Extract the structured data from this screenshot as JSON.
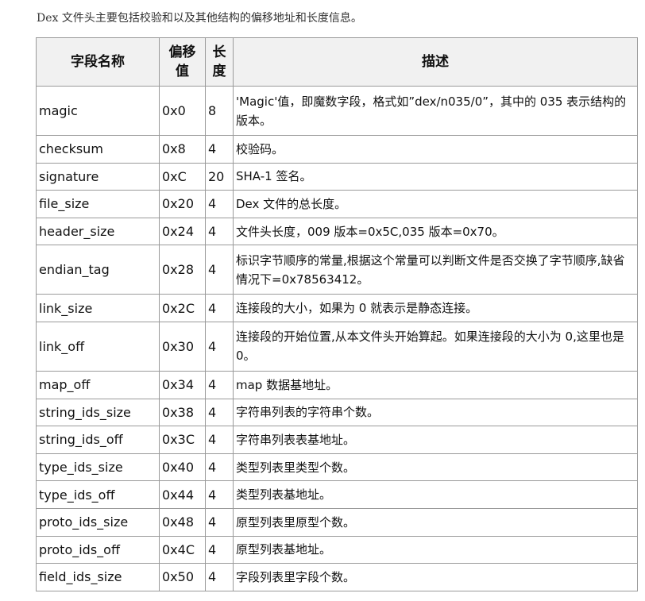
{
  "intro": "Dex 文件头主要包括校验和以及其他结构的偏移地址和长度信息。",
  "table": {
    "headers": {
      "field": "字段名称",
      "offset": "偏移值",
      "length": "长度",
      "description": "描述"
    },
    "rows": [
      {
        "field": "magic",
        "offset": "0x0",
        "length": "8",
        "description": "'Magic'值，即魔数字段，格式如”dex/n035/0”，其中的 035 表示结构的版本。"
      },
      {
        "field": "checksum",
        "offset": "0x8",
        "length": "4",
        "description": "校验码。"
      },
      {
        "field": "signature",
        "offset": "0xC",
        "length": "20",
        "description": "SHA-1 签名。"
      },
      {
        "field": "file_size",
        "offset": "0x20",
        "length": "4",
        "description": "Dex 文件的总长度。"
      },
      {
        "field": "header_size",
        "offset": "0x24",
        "length": "4",
        "description": "文件头长度，009 版本=0x5C,035 版本=0x70。"
      },
      {
        "field": "endian_tag",
        "offset": "0x28",
        "length": "4",
        "description": "标识字节顺序的常量,根据这个常量可以判断文件是否交换了字节顺序,缺省情况下=0x78563412。"
      },
      {
        "field": "link_size",
        "offset": "0x2C",
        "length": "4",
        "description": "连接段的大小，如果为 0 就表示是静态连接。"
      },
      {
        "field": "link_off",
        "offset": "0x30",
        "length": "4",
        "description": "连接段的开始位置,从本文件头开始算起。如果连接段的大小为 0,这里也是 0。"
      },
      {
        "field": "map_off",
        "offset": "0x34",
        "length": "4",
        "description": "map 数据基地址。"
      },
      {
        "field": "string_ids_size",
        "offset": "0x38",
        "length": "4",
        "description": "字符串列表的字符串个数。"
      },
      {
        "field": "string_ids_off",
        "offset": "0x3C",
        "length": "4",
        "description": "字符串列表表基地址。"
      },
      {
        "field": "type_ids_size",
        "offset": "0x40",
        "length": "4",
        "description": "类型列表里类型个数。"
      },
      {
        "field": "type_ids_off",
        "offset": "0x44",
        "length": "4",
        "description": "类型列表基地址。"
      },
      {
        "field": "proto_ids_size",
        "offset": "0x48",
        "length": "4",
        "description": "原型列表里原型个数。"
      },
      {
        "field": "proto_ids_off",
        "offset": "0x4C",
        "length": "4",
        "description": "原型列表基地址。"
      },
      {
        "field": "field_ids_size",
        "offset": "0x50",
        "length": "4",
        "description": "字段列表里字段个数。"
      }
    ]
  }
}
